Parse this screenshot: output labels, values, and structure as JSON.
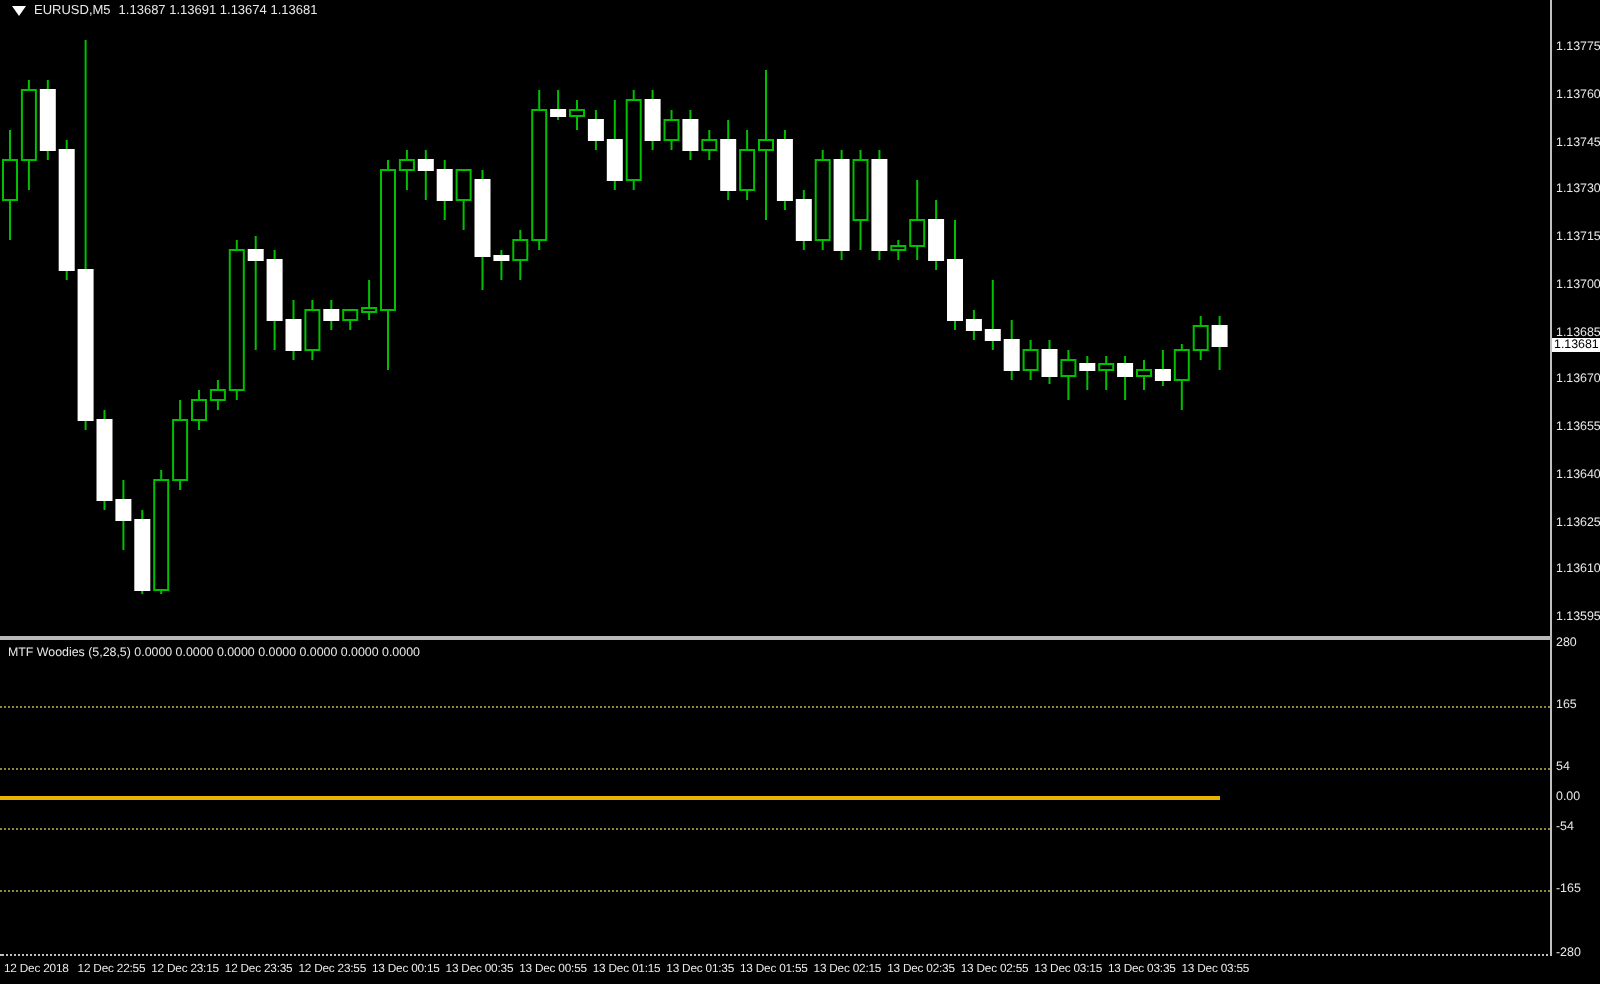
{
  "main_chart": {
    "symbol": "EURUSD,M5",
    "ohlc": "1.13687 1.13691 1.13674 1.13681",
    "current_price": "1.13681",
    "price_scale": [
      "1.13775",
      "1.13760",
      "1.13745",
      "1.13730",
      "1.13715",
      "1.13700",
      "1.13685",
      "1.13670",
      "1.13655",
      "1.13640",
      "1.13625",
      "1.13610",
      "1.13595"
    ]
  },
  "indicator": {
    "label": "MTF Woodies (5,28,5) 0.0000 0.0000 0.0000 0.0000 0.0000 0.0000 0.0000",
    "scale": [
      "280",
      "165",
      "54",
      "0.00",
      "-54",
      "-165",
      "-280"
    ]
  },
  "time_axis": [
    "12 Dec 2018",
    "12 Dec 22:55",
    "12 Dec 23:15",
    "12 Dec 23:35",
    "12 Dec 23:55",
    "13 Dec 00:15",
    "13 Dec 00:35",
    "13 Dec 00:55",
    "13 Dec 01:15",
    "13 Dec 01:35",
    "13 Dec 01:55",
    "13 Dec 02:15",
    "13 Dec 02:35",
    "13 Dec 02:55",
    "13 Dec 03:15",
    "13 Dec 03:35",
    "13 Dec 03:55"
  ]
}
